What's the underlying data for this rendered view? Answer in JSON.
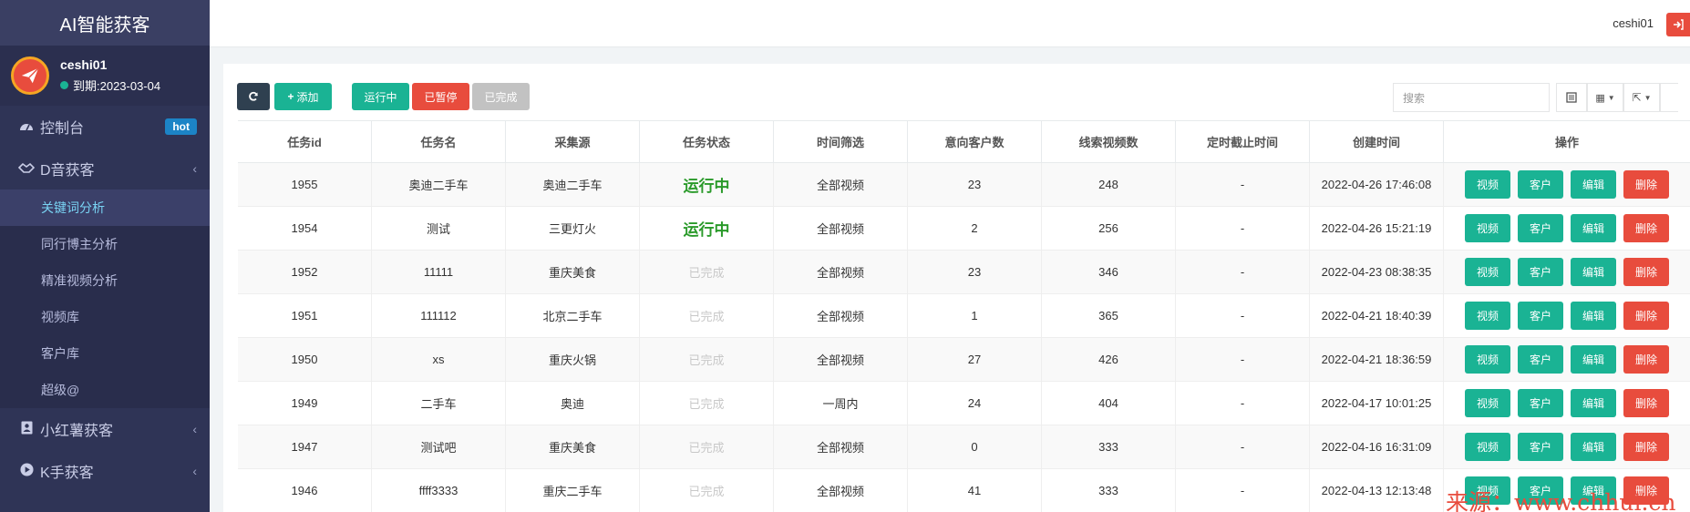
{
  "sidebar": {
    "brand": "AI智能获客",
    "user": {
      "name": "ceshi01",
      "expire": "到期:2023-03-04"
    },
    "menu": [
      {
        "label": "控制台",
        "badge": "hot",
        "icon": "dashboard-icon"
      },
      {
        "label": "D音获客",
        "icon": "handshake-icon",
        "subs": [
          {
            "label": "关键词分析",
            "active": true
          },
          {
            "label": "同行博主分析"
          },
          {
            "label": "精准视频分析"
          },
          {
            "label": "视频库"
          },
          {
            "label": "客户库"
          },
          {
            "label": "超级@"
          }
        ]
      },
      {
        "label": "小红薯获客",
        "icon": "address-book-icon"
      },
      {
        "label": "K手获客",
        "icon": "play-circle-icon"
      }
    ]
  },
  "topbar": {
    "user": "ceshi01"
  },
  "toolbar": {
    "add": "添加",
    "running": "运行中",
    "paused": "已暂停",
    "done": "已完成",
    "search_placeholder": "搜索"
  },
  "table": {
    "headers": [
      "任务id",
      "任务名",
      "采集源",
      "任务状态",
      "时间筛选",
      "意向客户数",
      "线索视频数",
      "定时截止时间",
      "创建时间",
      "操作"
    ],
    "op_labels": [
      "视频",
      "客户",
      "编辑",
      "删除"
    ],
    "rows": [
      {
        "id": "1955",
        "name": "奥迪二手车",
        "source": "奥迪二手车",
        "status": "运行中",
        "status_type": "running",
        "filter": "全部视频",
        "clients": "23",
        "videos": "248",
        "deadline": "-",
        "created": "2022-04-26 17:46:08"
      },
      {
        "id": "1954",
        "name": "测试",
        "source": "三更灯火",
        "status": "运行中",
        "status_type": "running",
        "filter": "全部视频",
        "clients": "2",
        "videos": "256",
        "deadline": "-",
        "created": "2022-04-26 15:21:19"
      },
      {
        "id": "1952",
        "name": "11111",
        "source": "重庆美食",
        "status": "已完成",
        "status_type": "done",
        "filter": "全部视频",
        "clients": "23",
        "videos": "346",
        "deadline": "-",
        "created": "2022-04-23 08:38:35"
      },
      {
        "id": "1951",
        "name": "111112",
        "source": "北京二手车",
        "status": "已完成",
        "status_type": "done",
        "filter": "全部视频",
        "clients": "1",
        "videos": "365",
        "deadline": "-",
        "created": "2022-04-21 18:40:39"
      },
      {
        "id": "1950",
        "name": "xs",
        "source": "重庆火锅",
        "status": "已完成",
        "status_type": "done",
        "filter": "全部视频",
        "clients": "27",
        "videos": "426",
        "deadline": "-",
        "created": "2022-04-21 18:36:59"
      },
      {
        "id": "1949",
        "name": "二手车",
        "source": "奥迪",
        "status": "已完成",
        "status_type": "done",
        "filter": "一周内",
        "clients": "24",
        "videos": "404",
        "deadline": "-",
        "created": "2022-04-17 10:01:25"
      },
      {
        "id": "1947",
        "name": "测试吧",
        "source": "重庆美食",
        "status": "已完成",
        "status_type": "done",
        "filter": "全部视频",
        "clients": "0",
        "videos": "333",
        "deadline": "-",
        "created": "2022-04-16 16:31:09"
      },
      {
        "id": "1946",
        "name": "ffff3333",
        "source": "重庆二手车",
        "status": "已完成",
        "status_type": "done",
        "filter": "全部视频",
        "clients": "41",
        "videos": "333",
        "deadline": "-",
        "created": "2022-04-13 12:13:48"
      }
    ]
  },
  "watermark": "来源：www.chhui.cn"
}
